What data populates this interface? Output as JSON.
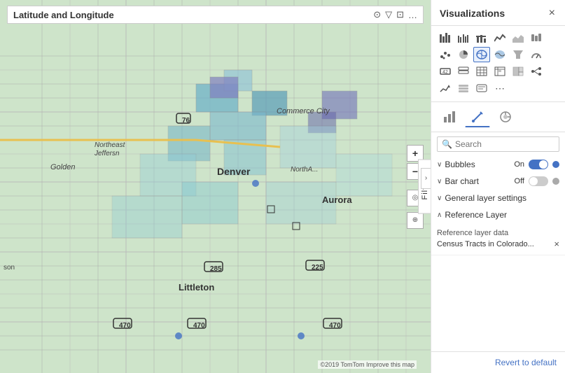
{
  "panel": {
    "title": "Visualizations",
    "close_label": "×",
    "search_placeholder": "Search",
    "search_label": "Search"
  },
  "map": {
    "title": "Latitude and Longitude",
    "copyright": "©2019 TomTom  Improve this map",
    "filters_label": "Filters"
  },
  "sections": {
    "bubbles": {
      "label": "Bubbles",
      "value": "On",
      "toggle_state": "on"
    },
    "bar_chart": {
      "label": "Bar chart",
      "value": "Off",
      "toggle_state": "off"
    },
    "general_layer": {
      "label": "General layer settings"
    },
    "reference_layer": {
      "label": "Reference Layer",
      "data_label": "Reference layer data",
      "data_value": "Census Tracts in Colorado..."
    }
  },
  "buttons": {
    "revert": "Revert to default"
  },
  "icons": {
    "rows": [
      [
        "▦",
        "📊",
        "⊞",
        "📈",
        "▬",
        "⊟"
      ],
      [
        "📉",
        "🗺",
        "⊠",
        "⊡",
        "🔢",
        "⊞"
      ],
      [
        "🗺",
        "🗺",
        "🗺",
        "⊞",
        "⊠",
        "⊡"
      ],
      [
        "⊞",
        "⊠",
        "⊡",
        "🔢",
        "⊞",
        "⊠"
      ],
      [
        "💬",
        "⊞",
        "⊠",
        "⋯",
        "",
        ""
      ]
    ],
    "tab_icons": [
      "⊞",
      "⊠",
      "⊡"
    ]
  }
}
